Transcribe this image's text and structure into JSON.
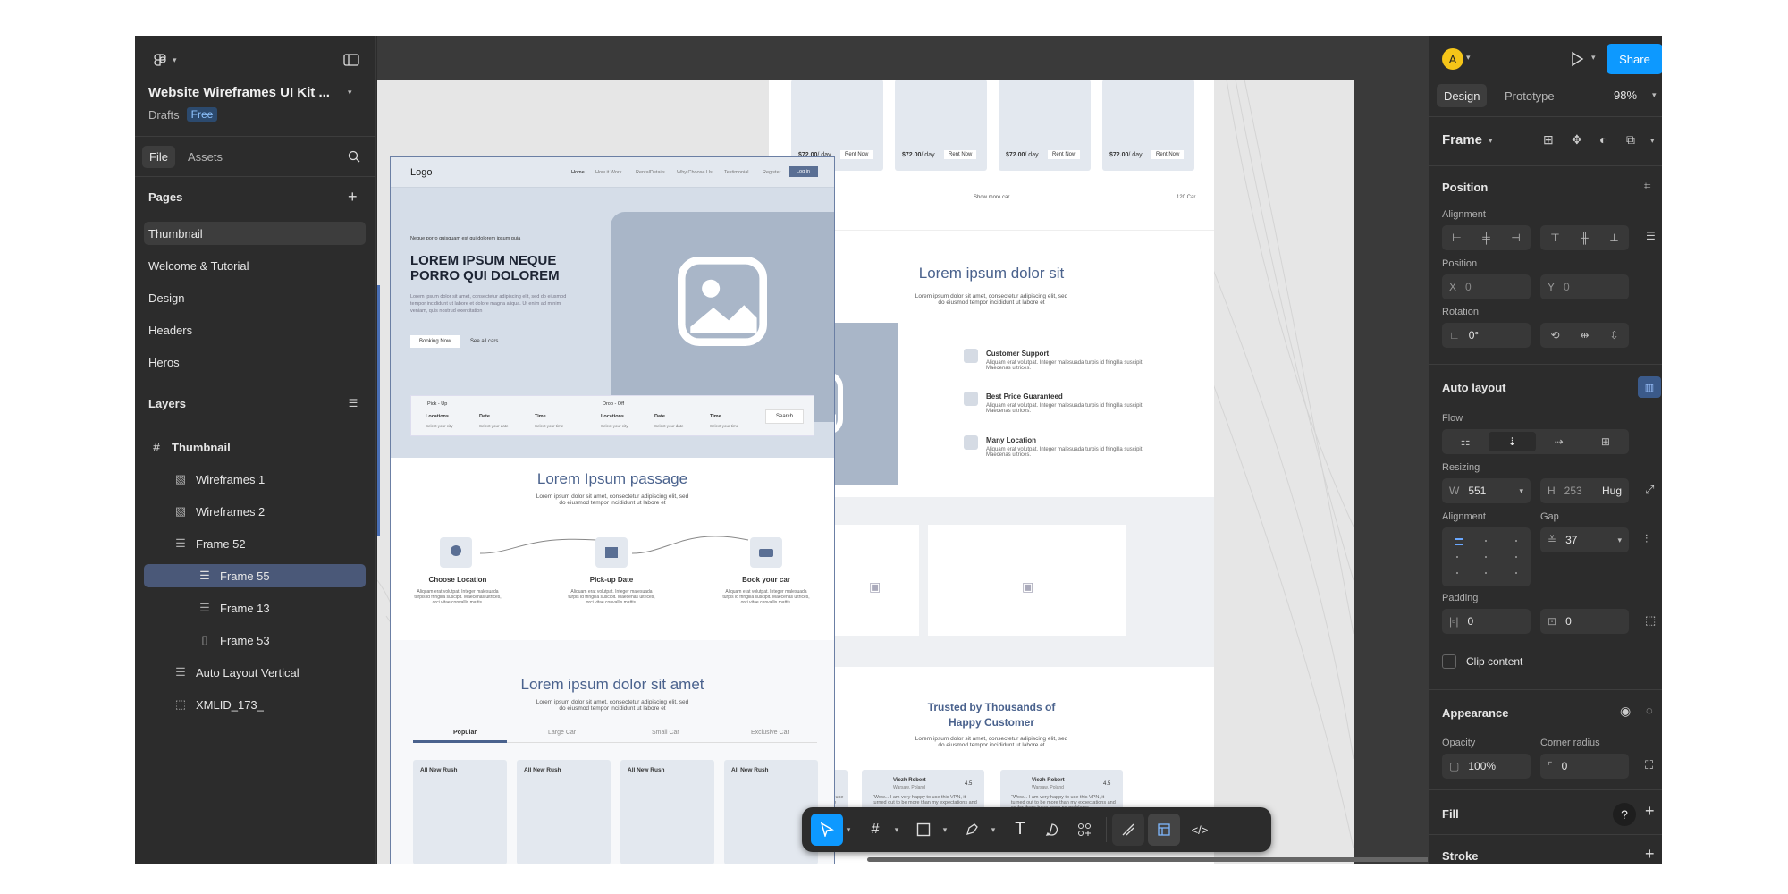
{
  "left": {
    "file_title": "Website Wireframes UI Kit ...",
    "drafts": "Drafts",
    "plan_badge": "Free",
    "tabs": [
      "File",
      "Assets"
    ],
    "pages_label": "Pages",
    "pages": [
      "Thumbnail",
      "Welcome  & Tutorial",
      "Design",
      "Headers",
      "Heros"
    ],
    "layers_label": "Layers",
    "layers": [
      "Thumbnail",
      "Wireframes 1",
      "Wireframes 2",
      "Frame 52",
      "Frame 55",
      "Frame 13",
      "Frame 53",
      "Auto Layout Vertical",
      "XMLID_173_"
    ]
  },
  "right": {
    "avatar_letter": "A",
    "share": "Share",
    "tabs": [
      "Design",
      "Prototype"
    ],
    "zoom": "98%",
    "frame_label": "Frame",
    "position_label": "Position",
    "alignment_label": "Alignment",
    "position_sub": "Position",
    "x_label": "X",
    "x_value": "0",
    "y_label": "Y",
    "y_value": "0",
    "rotation_label": "Rotation",
    "rotation_value": "0°",
    "autolayout_label": "Auto layout",
    "flow_label": "Flow",
    "resizing_label": "Resizing",
    "w_label": "W",
    "w_value": "551",
    "h_label": "H",
    "h_value": "253",
    "h_mode": "Hug",
    "al_alignment_label": "Alignment",
    "gap_label": "Gap",
    "gap_value": "37",
    "padding_label": "Padding",
    "pad_h": "0",
    "pad_v": "0",
    "clip_label": "Clip content",
    "appearance_label": "Appearance",
    "opacity_label": "Opacity",
    "opacity_value": "100%",
    "radius_label": "Corner radius",
    "radius_value": "0",
    "fill_label": "Fill",
    "stroke_label": "Stroke"
  },
  "canvas": {
    "logo": "Logo",
    "nav": [
      "Home",
      "How it Work",
      "RentalDetails",
      "Why Choose Us",
      "Testimonial",
      "Register"
    ],
    "login": "Log in",
    "tagline": "Neque porro quisquam est qui dolorem ipsum quia",
    "hero_title_1": "LOREM IPSUM NEQUE",
    "hero_title_2": "PORRO QUI DOLOREM",
    "hero_body": "Lorem ipsum dolor sit amet, consectetur adipiscing elit, sed do eiusmod tempor incididunt ut labore et dolore magna aliqua. Ut enim ad minim veniam, quis nostrud exercitation",
    "booking_btn": "Booking Now",
    "see_all": "See all cars",
    "pickup": "Pick - Up",
    "dropoff": "Drop - Off",
    "f_location": "Locations",
    "f_date": "Date",
    "f_time": "Time",
    "f_loc_sub": "Select your city",
    "f_date_sub": "Select your date",
    "f_time_sub": "Select your time",
    "search_btn": "Search",
    "passage_title": "Lorem Ipsum passage",
    "passage_sub_1": "Lorem ipsum dolor sit amet, consectetur adipiscing elit, sed",
    "passage_sub_2": "do eiusmod tempor incididunt ut labore et",
    "steps": [
      "Choose Location",
      "Pick-up Date",
      "Book your car"
    ],
    "step_body": "Aliquam erat volutpat. Integer malesuada turpis id fringilla suscipit. Maecenas ultrices, orci vitae convallis mattis.",
    "section3_title": "Lorem ipsum dolor sit amet",
    "tabs": [
      "Popular",
      "Large Car",
      "Small Car",
      "Exclusive Car"
    ],
    "car_name": "All New Rush",
    "price": "$72.00",
    "per_day": "/ day",
    "rent": "Rent Now",
    "show_more": "Show more car",
    "count": "120 Car",
    "b_title": "Lorem ipsum dolor sit",
    "features": [
      "Customer Support",
      "Best Price Guaranteed",
      "Many Location"
    ],
    "feature_body": "Aliquam erat volutpat. Integer malesuada turpis id fringilla suscipit. Maecenas ultrices.",
    "trusted_1": "Trusted by Thousands of",
    "trusted_2": "Happy Customer",
    "reviewer": "Viezh Robert",
    "reviewer_loc": "Warsaw, Poland",
    "rating": "4.5",
    "review": "“Wow... I am very happy to use this VPN, it turned out to be more than my expectations and so far there have been no problems."
  },
  "colors": {
    "accent": "#0d99ff",
    "selection": "#4a5878",
    "avatar": "#f5c518",
    "wire_blue": "#4a628d"
  }
}
